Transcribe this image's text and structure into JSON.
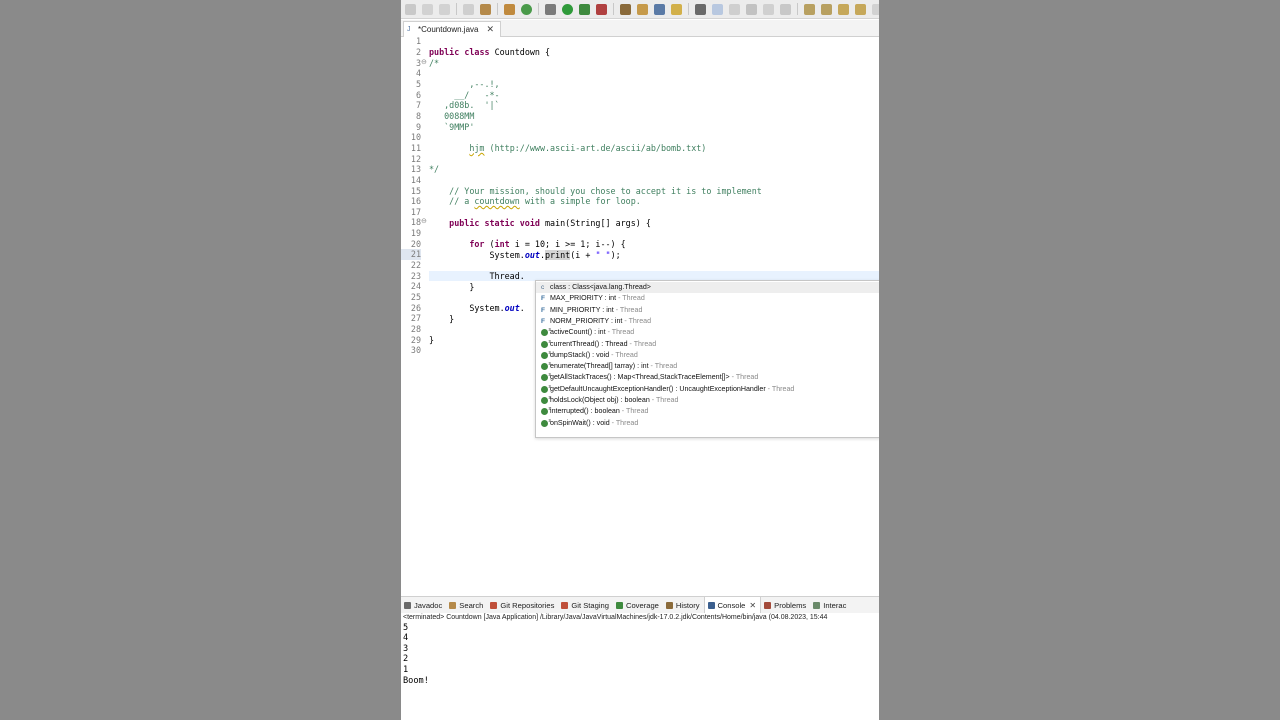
{
  "colors": {
    "keyword": "#7f0055",
    "comment": "#3f7f5f",
    "string": "#2a00ff",
    "static_field": "#0000c0",
    "accent": "#e8f2fe"
  },
  "editor": {
    "tab_title": "*Countdown.java",
    "line_numbers": [
      "1",
      "2",
      "3",
      "4",
      "5",
      "6",
      "7",
      "8",
      "9",
      "10",
      "11",
      "12",
      "13",
      "14",
      "15",
      "16",
      "17",
      "18",
      "19",
      "20",
      "21",
      "22",
      "23",
      "24",
      "25",
      "26",
      "27",
      "28",
      "29",
      "30"
    ],
    "code": {
      "l2_kw1": "public",
      "l2_kw2": "class",
      "l2_name": " Countdown {",
      "l3": "/*",
      "l5": "        ,--.!,",
      "l6": "     __/   -*-",
      "l7": "   ,d08b.  '|`",
      "l8": "   0088MM",
      "l9": "   `9MMP'",
      "l11_a": "        ",
      "l11_author": "hjm",
      "l11_b": " (http://www.ascii-art.de/ascii/ab/bomb.txt)",
      "l13": "*/",
      "l15": "    // Your mission, should you chose to accept it is to implement",
      "l16_a": "    // a ",
      "l16_word": "countdown",
      "l16_b": " with a simple for loop.",
      "l18_kw": "public static void",
      "l18_rest": " main(String[] args) {",
      "l20_kw": "for",
      "l20_a": " (",
      "l20_kw2": "int",
      "l20_b": " i = 10; i >= 1; i--) {",
      "l21_a": "System.",
      "l21_out": "out",
      "l21_dot": ".",
      "l21_print": "print",
      "l21_b": "(i + ",
      "l21_str": "\" \"",
      "l21_c": ");",
      "l23": "Thread.",
      "l24": "}",
      "l26_a": "System.",
      "l26_out": "out",
      "l26_b": ".",
      "l27": "}",
      "l29": "}"
    }
  },
  "assist": {
    "items": [
      {
        "icon": "class-icon",
        "name": "class : Class<java.lang.Thread>",
        "owner": ""
      },
      {
        "icon": "static-field-icon",
        "name": "MAX_PRIORITY : int",
        "owner": " - Thread"
      },
      {
        "icon": "static-field-icon",
        "name": "MIN_PRIORITY : int",
        "owner": " - Thread"
      },
      {
        "icon": "static-field-icon",
        "name": "NORM_PRIORITY : int",
        "owner": " - Thread"
      },
      {
        "icon": "static-method-icon",
        "name": "activeCount() : int",
        "owner": " - Thread"
      },
      {
        "icon": "static-method-icon",
        "name": "currentThread() : Thread",
        "owner": " - Thread"
      },
      {
        "icon": "static-method-icon",
        "name": "dumpStack() : void",
        "owner": " - Thread"
      },
      {
        "icon": "static-method-icon",
        "name": "enumerate(Thread[] tarray) : int",
        "owner": " - Thread"
      },
      {
        "icon": "static-method-icon",
        "name": "getAllStackTraces() : Map<Thread,StackTraceElement[]>",
        "owner": " - Thread"
      },
      {
        "icon": "static-method-icon",
        "name": "getDefaultUncaughtExceptionHandler() : UncaughtExceptionHandler",
        "owner": " - Thread"
      },
      {
        "icon": "static-method-icon",
        "name": "holdsLock(Object obj) : boolean",
        "owner": " - Thread"
      },
      {
        "icon": "static-method-icon",
        "name": "interrupted() : boolean",
        "owner": " - Thread"
      },
      {
        "icon": "static-method-icon",
        "name": "onSpinWait() : void",
        "owner": " - Thread"
      }
    ]
  },
  "console": {
    "tabs": [
      {
        "label": "Javadoc",
        "icon": "javadoc-icon"
      },
      {
        "label": "Search",
        "icon": "search-icon"
      },
      {
        "label": "Git Repositories",
        "icon": "git-repositories-icon"
      },
      {
        "label": "Git Staging",
        "icon": "git-staging-icon"
      },
      {
        "label": "Coverage",
        "icon": "coverage-icon"
      },
      {
        "label": "History",
        "icon": "history-icon"
      },
      {
        "label": "Console",
        "icon": "console-icon"
      },
      {
        "label": "Problems",
        "icon": "problems-icon"
      },
      {
        "label": "Interac",
        "icon": "interactive-icon"
      }
    ],
    "status": "<terminated> Countdown [Java Application] /Library/Java/JavaVirtualMachines/jdk-17.0.2.jdk/Contents/Home/bin/java  (04.08.2023, 15:44",
    "output": [
      "5",
      "4",
      "3",
      "2",
      "1",
      "Boom!"
    ]
  }
}
